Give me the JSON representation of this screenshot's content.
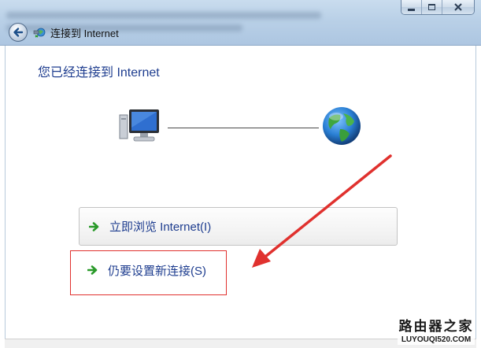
{
  "window": {
    "nav_title": "连接到 Internet",
    "minimize_icon": "minimize-icon",
    "maximize_icon": "maximize-icon",
    "close_icon": "close-icon",
    "back_icon": "back-arrow-icon",
    "network_icon": "network-connection-icon"
  },
  "main": {
    "heading": "您已经连接到 Internet",
    "computer_icon": "computer-icon",
    "globe_icon": "globe-icon",
    "options": [
      {
        "label": "立即浏览 Internet(I)",
        "icon": "green-arrow-icon"
      },
      {
        "label": "仍要设置新连接(S)",
        "icon": "green-arrow-icon"
      }
    ]
  },
  "annotation": {
    "color": "#e0312e"
  },
  "watermark": {
    "title": "路由器之家",
    "url": "LUYOUQI520.COM"
  },
  "colors": {
    "heading": "#1e3d8f",
    "link": "#1e3d8f",
    "arrow_green": "#2a9a2a",
    "title_bar": "#b9d0e7"
  }
}
